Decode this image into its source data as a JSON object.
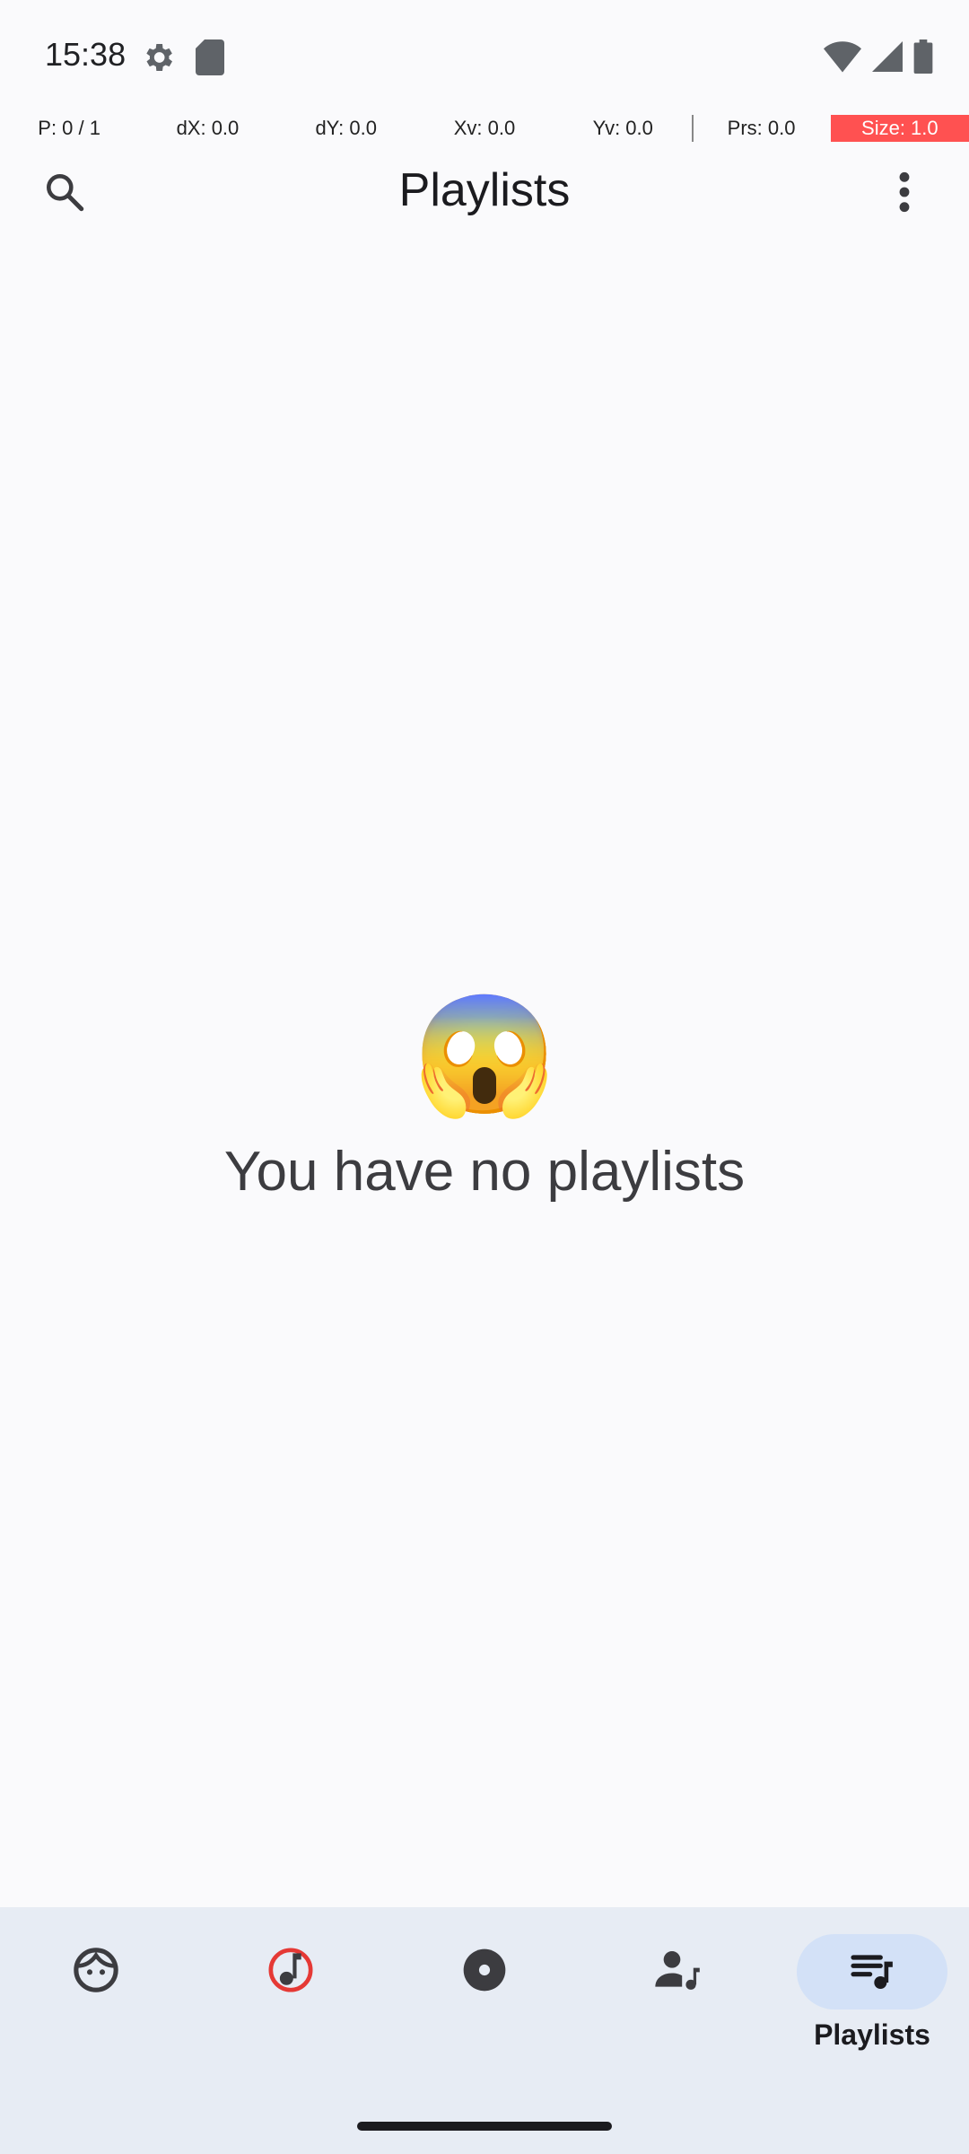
{
  "status_bar": {
    "time": "15:38",
    "left_icons": [
      "settings-icon",
      "sd-card-icon"
    ],
    "right_icons": [
      "wifi-icon",
      "cellular-icon",
      "battery-icon"
    ]
  },
  "pointer_overlay": {
    "cells": [
      "P: 0 / 1",
      "dX: 0.0",
      "dY: 0.0",
      "Xv: 0.0",
      "Yv: 0.0",
      "Prs: 0.0",
      "Size: 1.0"
    ]
  },
  "app_bar": {
    "title": "Playlists",
    "search_icon": "search-icon",
    "more_icon": "more-vert-icon"
  },
  "empty_state": {
    "emoji": "😱",
    "message": "You have no playlists"
  },
  "bottom_nav": {
    "items": [
      {
        "icon": "face-icon",
        "label": ""
      },
      {
        "icon": "music-note-icon",
        "label": ""
      },
      {
        "icon": "album-icon",
        "label": ""
      },
      {
        "icon": "artist-icon",
        "label": ""
      },
      {
        "icon": "playlist-icon",
        "label": "Playlists",
        "active": true
      }
    ]
  },
  "colors": {
    "background": "#fafafc",
    "nav_background": "#e7ecf4",
    "active_pill": "#d3e1f7",
    "accent_red": "#e53935",
    "overlay_highlight": "#ff5151"
  }
}
